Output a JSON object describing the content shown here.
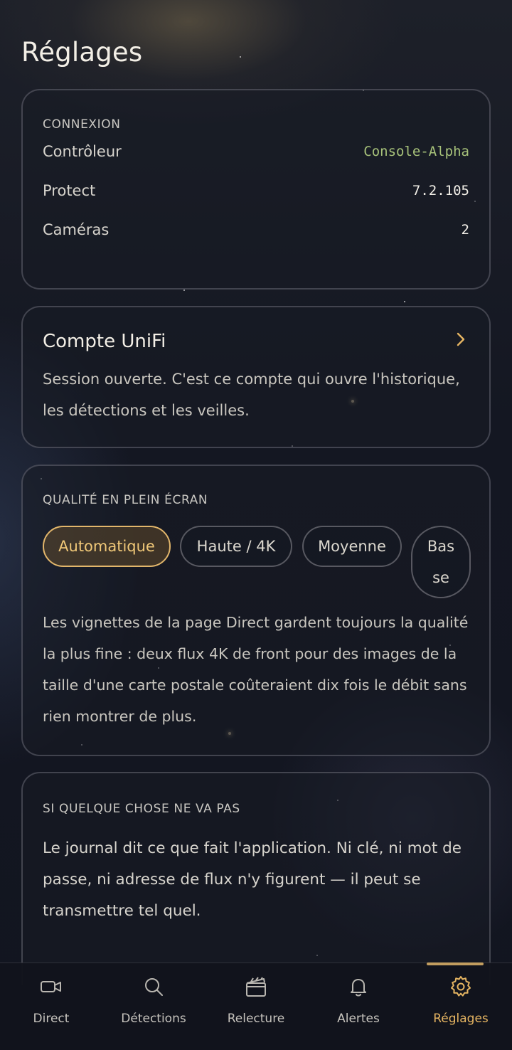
{
  "page": {
    "title": "Réglages"
  },
  "connexion": {
    "label": "CONNEXION",
    "rows": [
      {
        "key": "Contrôleur",
        "value": "Console-Alpha"
      },
      {
        "key": "Protect",
        "value": "7.2.105"
      },
      {
        "key": "Caméras",
        "value": "2"
      }
    ]
  },
  "account": {
    "title": "Compte UniFi",
    "description": "Session ouverte. C'est ce compte qui ouvre l'historique, les détections et les veilles."
  },
  "quality": {
    "label": "QUALITÉ EN PLEIN ÉCRAN",
    "options": [
      "Automatique",
      "Haute / 4K",
      "Moyenne",
      "Bas se"
    ],
    "selected": "Automatique",
    "description": "Les vignettes de la page Direct gardent toujours la qualité la plus fine : deux flux 4K de front pour des images de la taille d'une carte postale coûteraient dix fois le débit sans rien montrer de plus."
  },
  "issues": {
    "label": "SI QUELQUE CHOSE NE VA PAS",
    "description": "Le journal dit ce que fait l'application. Ni clé, ni mot de passe, ni adresse de flux n'y figurent — il peut se transmettre tel quel."
  },
  "nav": {
    "items": [
      {
        "label": "Direct",
        "icon": "video-camera-icon"
      },
      {
        "label": "Détections",
        "icon": "search-icon"
      },
      {
        "label": "Relecture",
        "icon": "clapperboard-icon"
      },
      {
        "label": "Alertes",
        "icon": "bell-icon"
      },
      {
        "label": "Réglages",
        "icon": "gear-icon"
      }
    ],
    "active": "Réglages"
  },
  "colors": {
    "accent": "#e2b66b",
    "controller_value": "#a7c27a",
    "background": "#141722"
  }
}
